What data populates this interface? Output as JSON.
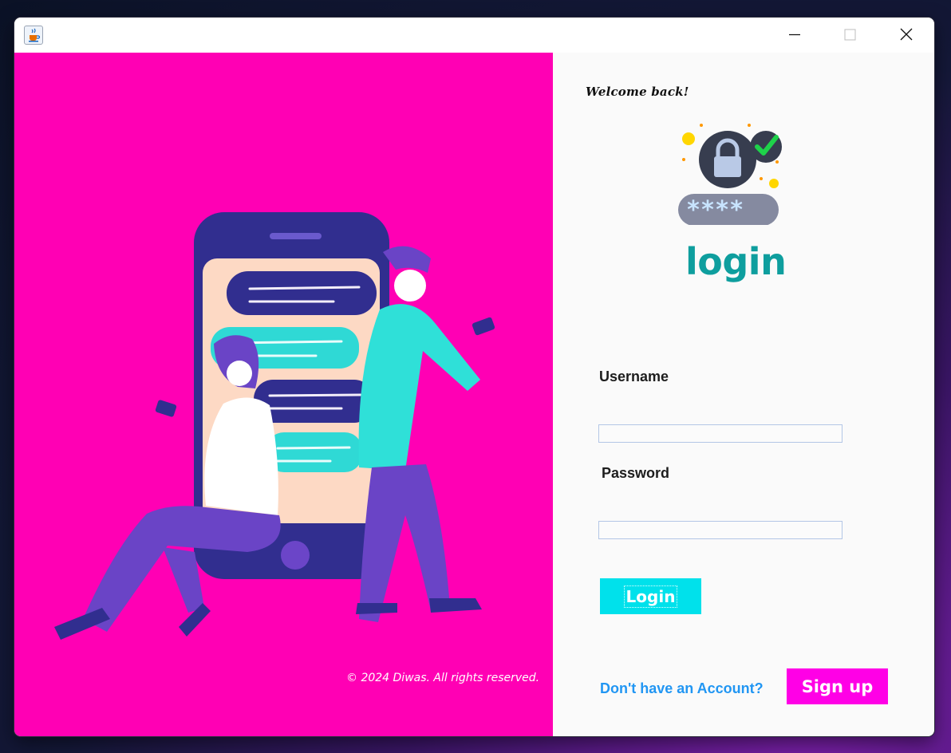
{
  "window": {
    "icon": "java-cup-icon",
    "controls": {
      "minimize": "minimize-icon",
      "maximize": "maximize-icon",
      "close": "close-icon"
    }
  },
  "left_panel": {
    "background": "#ff00b4",
    "copyright": "© 2024 Diwas. All rights reserved."
  },
  "right_panel": {
    "welcome": "Welcome back!",
    "title": "login",
    "password_mask": "****",
    "username": {
      "label": "Username",
      "value": ""
    },
    "password": {
      "label": "Password",
      "value": ""
    },
    "login_button": "Login",
    "no_account_text": "Don't have an Account?",
    "signup_button": "Sign up"
  },
  "colors": {
    "title": "#0e9e9e",
    "login_button": "#00e1eb",
    "signup_button": "#ff00e6",
    "link": "#2196f3"
  }
}
